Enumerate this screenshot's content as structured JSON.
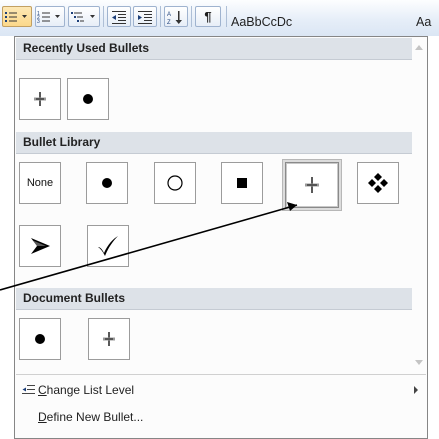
{
  "toolbar": {
    "buttons": [
      {
        "name": "bullets-button",
        "icon": "bullet-list-icon"
      },
      {
        "name": "numbering-button",
        "icon": "numbered-list-icon"
      },
      {
        "name": "multilevel-list-button",
        "icon": "multilevel-list-icon"
      },
      {
        "name": "decrease-indent-button",
        "icon": "decrease-indent-icon"
      },
      {
        "name": "increase-indent-button",
        "icon": "increase-indent-icon"
      },
      {
        "name": "sort-button",
        "icon": "sort-az-icon"
      },
      {
        "name": "show-formatting-button",
        "icon": "pilcrow-icon"
      }
    ],
    "styles_preview_1": "AaBbCcDc",
    "styles_preview_2": "Aa",
    "pilcrow": "¶"
  },
  "menu": {
    "recently_used": {
      "title": "Recently Used Bullets",
      "items": [
        {
          "icon": "pushpin-bullet-icon"
        },
        {
          "icon": "filled-circle-bullet-icon"
        }
      ]
    },
    "library": {
      "title": "Bullet Library",
      "none_label": "None",
      "items": [
        {
          "icon": "none"
        },
        {
          "icon": "filled-circle-bullet-icon"
        },
        {
          "icon": "hollow-circle-bullet-icon"
        },
        {
          "icon": "filled-square-bullet-icon"
        },
        {
          "icon": "pushpin-bullet-icon",
          "selected": true
        },
        {
          "icon": "four-diamond-bullet-icon"
        },
        {
          "icon": "arrowhead-bullet-icon"
        },
        {
          "icon": "checkmark-bullet-icon"
        }
      ]
    },
    "document": {
      "title": "Document Bullets",
      "items": [
        {
          "icon": "filled-circle-bullet-icon"
        },
        {
          "icon": "pushpin-bullet-icon"
        }
      ]
    },
    "change_list_level": {
      "mnemonic": "C",
      "rest": "hange List Level"
    },
    "define_new_bullet": {
      "mnemonic": "D",
      "rest": "efine New Bullet..."
    }
  },
  "colors": {
    "menu_header_bg": "#dde2e8",
    "toolbar_bg": "#dbe6f4",
    "selected_border": "#8a8a8a",
    "callout_line": "#000000"
  }
}
